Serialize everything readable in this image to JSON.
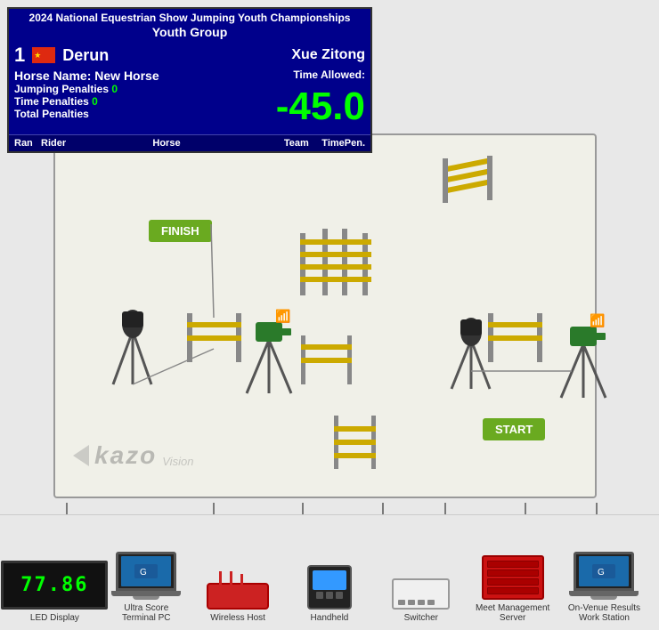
{
  "scoreboard": {
    "title": "2024 National Equestrian Show Jumping Youth Championships",
    "group": "Youth Group",
    "rider_number": "1",
    "rider_name": "Derun",
    "rider_name2": "Xue Zitong",
    "horse_label": "Horse Name:",
    "horse_name": "New Horse",
    "time_allowed_label": "Time Allowed:",
    "jumping_label": "Jumping Penalties",
    "jumping_value": "0",
    "time_pen_label": "Time Penalties",
    "time_pen_value": "0",
    "total_label": "Total Penalties",
    "big_time": "-45.0",
    "table_headers": [
      "Ran",
      "Rider",
      "Horse",
      "Team",
      "Time",
      "Pen."
    ]
  },
  "arena": {
    "finish_label": "FINISH",
    "start_label": "START"
  },
  "equipment": [
    {
      "id": "led",
      "label": "LED Display"
    },
    {
      "id": "ultrapc",
      "label": "Ultra Score\nTerminal PC"
    },
    {
      "id": "wireless",
      "label": "Wireless Host"
    },
    {
      "id": "handheld",
      "label": "Handheld"
    },
    {
      "id": "switcher",
      "label": "Switcher"
    },
    {
      "id": "server",
      "label": "Meet Management\nServer"
    },
    {
      "id": "onvenue",
      "label": "On-Venue Results\nWork Station"
    }
  ],
  "kazo": {
    "text": "kazo",
    "vision": "Vision"
  }
}
